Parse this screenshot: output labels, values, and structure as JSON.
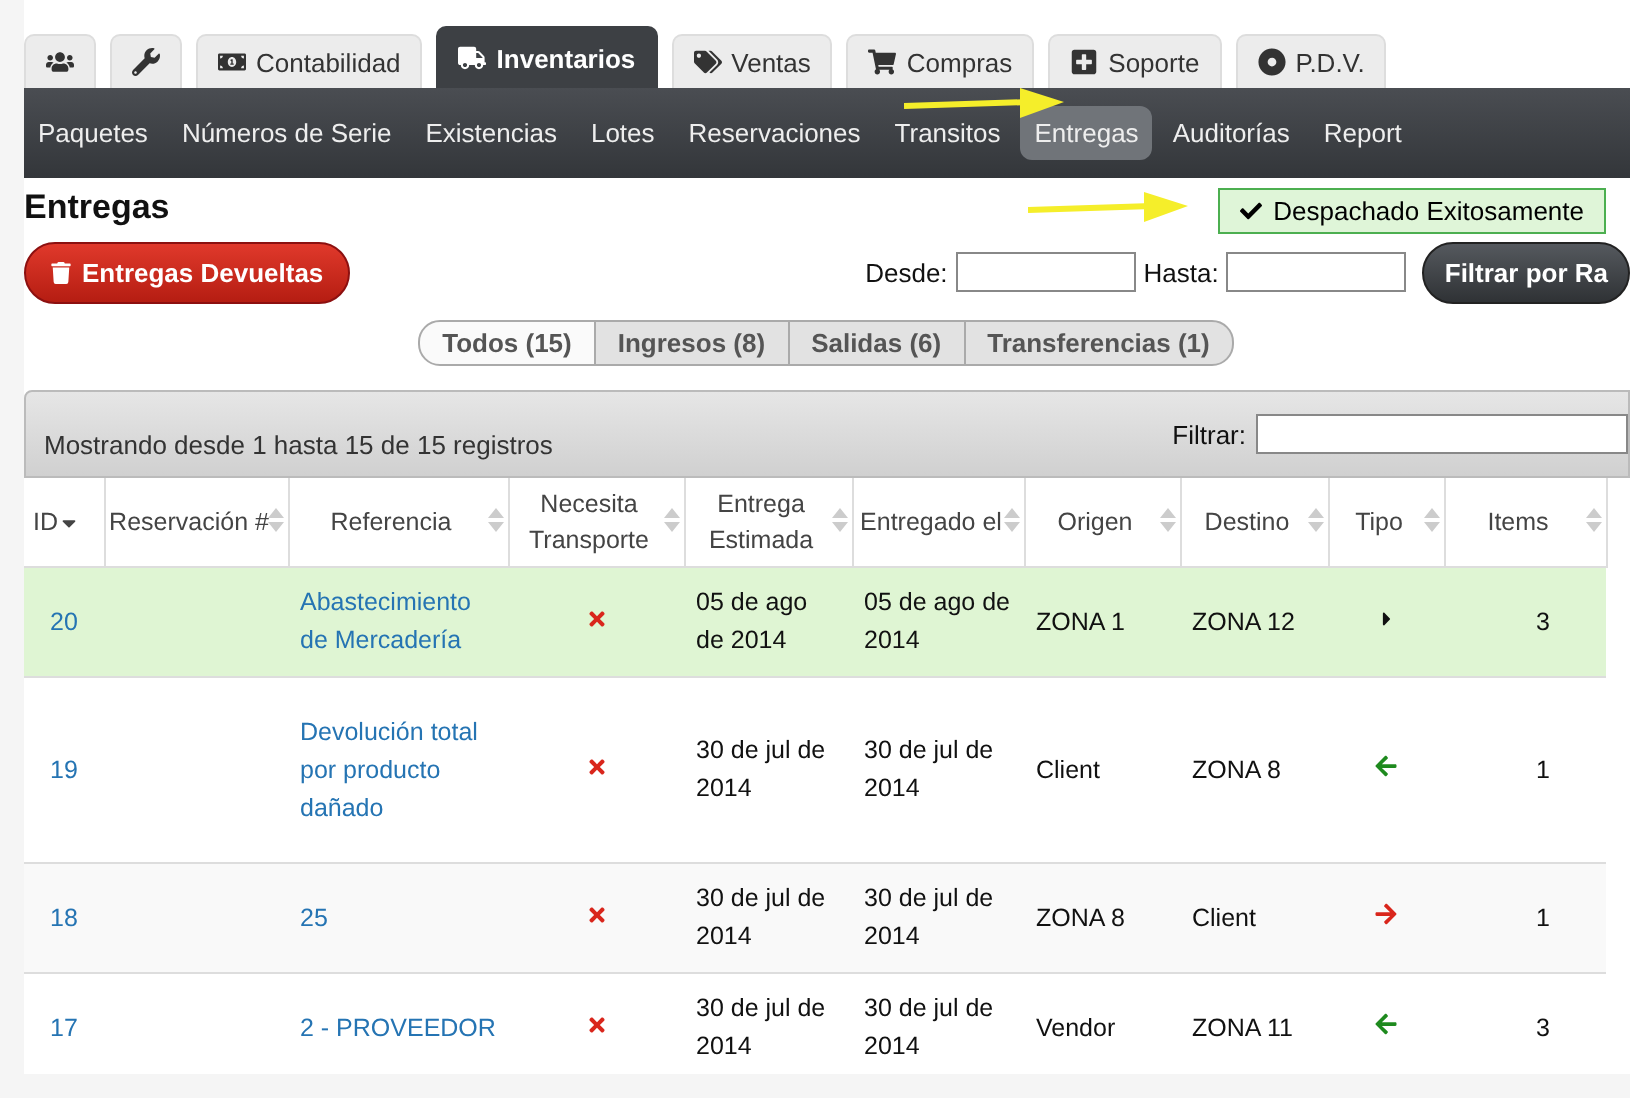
{
  "top_tabs": [
    {
      "selected": false
    },
    {
      "selected": false
    },
    {
      "label": "Contabilidad",
      "selected": false
    },
    {
      "label": "Inventarios",
      "selected": true
    },
    {
      "label": "Ventas",
      "selected": false
    },
    {
      "label": "Compras",
      "selected": false
    },
    {
      "label": "Soporte",
      "selected": false
    },
    {
      "label": "P.D.V.",
      "selected": false
    }
  ],
  "sub_nav": [
    {
      "label": "Paquetes",
      "selected": false
    },
    {
      "label": "Números de Serie",
      "selected": false
    },
    {
      "label": "Existencias",
      "selected": false
    },
    {
      "label": "Lotes",
      "selected": false
    },
    {
      "label": "Reservaciones",
      "selected": false
    },
    {
      "label": "Transitos",
      "selected": false
    },
    {
      "label": "Entregas",
      "selected": true
    },
    {
      "label": "Auditorías",
      "selected": false
    },
    {
      "label": "Report",
      "selected": false
    }
  ],
  "page_title": "Entregas",
  "alert": "Despachado Exitosamente",
  "returns_button": "Entregas Devueltas",
  "date_filter": {
    "from_label": "Desde:",
    "to_label": "Hasta:",
    "button": "Filtrar por Ra"
  },
  "filter_tabs": [
    {
      "label": "Todos (15)",
      "selected": true
    },
    {
      "label": "Ingresos (8)",
      "selected": false
    },
    {
      "label": "Salidas (6)",
      "selected": false
    },
    {
      "label": "Transferencias (1)",
      "selected": false
    }
  ],
  "table": {
    "info": "Mostrando desde 1 hasta 15 de 15 registros",
    "filter_label": "Filtrar:",
    "columns": [
      {
        "label": "ID",
        "sorted": true
      },
      {
        "label": "Reservación #",
        "sorted": false
      },
      {
        "label": "Referencia",
        "sorted": false
      },
      {
        "label": "Necesita Transporte",
        "sorted": false
      },
      {
        "label": "Entrega Estimada",
        "sorted": false
      },
      {
        "label": "Entregado el",
        "sorted": false
      },
      {
        "label": "Origen",
        "sorted": false
      },
      {
        "label": "Destino",
        "sorted": false
      },
      {
        "label": "Tipo",
        "sorted": false
      },
      {
        "label": "Items",
        "sorted": false
      }
    ],
    "rows": [
      {
        "id": "20",
        "reference": "Abastecimiento de Mercadería",
        "estimated": "05 de ago de 2014",
        "delivered": "05 de ago de 2014",
        "origin": "ZONA 1",
        "destination": "ZONA 12",
        "kind": "transfer",
        "items": "3",
        "highlighted": true
      },
      {
        "id": "19",
        "reference": "Devolución total por producto dañado",
        "estimated": "30 de jul de 2014",
        "delivered": "30 de jul de 2014",
        "origin": "Client",
        "destination": "ZONA 8",
        "kind": "incoming",
        "items": "1",
        "highlighted": false
      },
      {
        "id": "18",
        "reference": "25",
        "estimated": "30 de jul de 2014",
        "delivered": "30 de jul de 2014",
        "origin": "ZONA 8",
        "destination": "Client",
        "kind": "outgoing",
        "items": "1",
        "highlighted": false
      },
      {
        "id": "17",
        "reference": "2 - PROVEEDOR",
        "estimated": "30 de jul de 2014",
        "delivered": "30 de jul de 2014",
        "origin": "Vendor",
        "destination": "ZONA 11",
        "kind": "incoming",
        "items": "3",
        "highlighted": false
      }
    ]
  }
}
